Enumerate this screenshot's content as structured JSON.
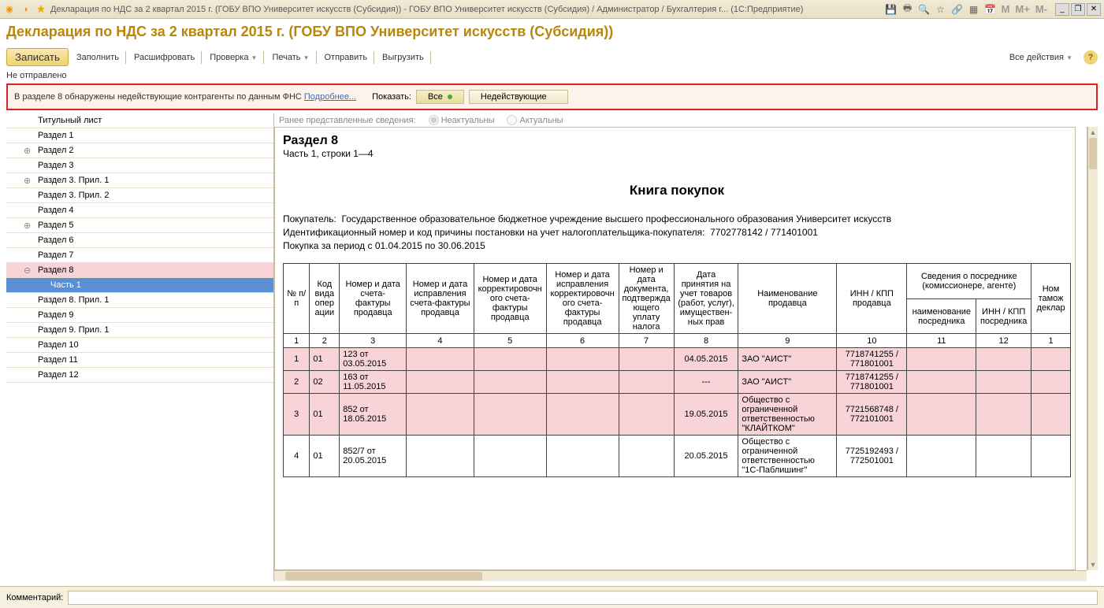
{
  "titlebar": {
    "text": "Декларация по НДС за 2 квартал 2015 г. (ГОБУ ВПО Университет искусств (Субсидия)) - ГОБУ ВПО Университет искусств (Субсидия) / Администратор / Бухгалтерия г...  (1С:Предприятие)"
  },
  "page_title": "Декларация по НДС за 2 квартал 2015 г. (ГОБУ ВПО Университет искусств (Субсидия))",
  "toolbar": {
    "write": "Записать",
    "fill": "Заполнить",
    "decode": "Расшифровать",
    "check": "Проверка",
    "print": "Печать",
    "send": "Отправить",
    "export": "Выгрузить",
    "all_actions": "Все действия"
  },
  "status_line": "Не отправлено",
  "warning": {
    "text_before": "В разделе 8 обнаружены недействующие контрагенты по данным ФНС ",
    "link": "Подробнее...",
    "show_label": "Показать:",
    "btn_all": "Все",
    "btn_inactive": "Недействующие"
  },
  "sidebar": [
    {
      "label": "Титульный лист",
      "type": "plain"
    },
    {
      "label": "Раздел 1",
      "type": "plain"
    },
    {
      "label": "Раздел 2",
      "type": "expandable"
    },
    {
      "label": "Раздел 3",
      "type": "plain"
    },
    {
      "label": "Раздел 3. Прил. 1",
      "type": "expandable"
    },
    {
      "label": "Раздел 3. Прил. 2",
      "type": "plain"
    },
    {
      "label": "Раздел 4",
      "type": "plain"
    },
    {
      "label": "Раздел 5",
      "type": "expandable"
    },
    {
      "label": "Раздел 6",
      "type": "plain"
    },
    {
      "label": "Раздел 7",
      "type": "plain"
    },
    {
      "label": "Раздел 8",
      "type": "expanded",
      "highlighted": true
    },
    {
      "label": "Часть 1",
      "type": "child",
      "selected": true
    },
    {
      "label": "Раздел 8. Прил. 1",
      "type": "plain"
    },
    {
      "label": "Раздел 9",
      "type": "plain"
    },
    {
      "label": "Раздел 9. Прил. 1",
      "type": "plain"
    },
    {
      "label": "Раздел 10",
      "type": "plain"
    },
    {
      "label": "Раздел 11",
      "type": "plain"
    },
    {
      "label": "Раздел 12",
      "type": "plain"
    }
  ],
  "report_meta": {
    "prev_label": "Ранее представленные сведения:",
    "opt1": "Неактуальны",
    "opt2": "Актуальны"
  },
  "report": {
    "section_title": "Раздел 8",
    "section_sub": "Часть 1, строки 1—4",
    "center_title": "Книга покупок",
    "buyer_line1_label": "Покупатель:",
    "buyer_line1_value": "Государственное образовательное бюджетное учреждение высшего профессионального образования  Университет искусств",
    "buyer_line2_label": "Идентификационный номер и код причины постановки на учет налогоплательщика-покупателя:",
    "buyer_line2_value": "7702778142 / 771401001",
    "buyer_line3": "Покупка за период с 01.04.2015 по 30.06.2015"
  },
  "table": {
    "headers": {
      "c1": "№ п/п",
      "c2": "Код вида опер ации",
      "c3": "Номер и дата счета-фактуры продавца",
      "c4": "Номер и дата исправления счета-фактуры продавца",
      "c5": "Номер и дата корректировочн ого счета-фактуры продавца",
      "c6": "Номер и дата исправления корректировочн ого счета-фактуры продавца",
      "c7": "Номер и дата документа, подтвержда ющего уплату налога",
      "c8": "Дата принятия на учет товаров (работ, услуг), имуществен- ных прав",
      "c9": "Наименование продавца",
      "c10": "ИНН / КПП продавца",
      "c11_group": "Сведения о посреднике (комиссионере, агенте)",
      "c11": "наименование посредника",
      "c12": "ИНН / КПП посредника",
      "c13": "Ном тамож деклар"
    },
    "col_nums": [
      "1",
      "2",
      "3",
      "4",
      "5",
      "6",
      "7",
      "8",
      "9",
      "10",
      "11",
      "12",
      "1"
    ],
    "rows": [
      {
        "n": "1",
        "code": "01",
        "inv": "123 от 03.05.2015",
        "c4": "",
        "c5": "",
        "c6": "",
        "c7": "",
        "date": "04.05.2015",
        "seller": "ЗАО \"АИСТ\"",
        "inn": "7718741255 / 771801001",
        "c11": "",
        "c12": "",
        "c13": "",
        "pink": true
      },
      {
        "n": "2",
        "code": "02",
        "inv": "163 от 11.05.2015",
        "c4": "",
        "c5": "",
        "c6": "",
        "c7": "",
        "date": "---",
        "seller": "ЗАО \"АИСТ\"",
        "inn": "7718741255 / 771801001",
        "c11": "",
        "c12": "",
        "c13": "",
        "pink": true
      },
      {
        "n": "3",
        "code": "01",
        "inv": "852 от 18.05.2015",
        "c4": "",
        "c5": "",
        "c6": "",
        "c7": "",
        "date": "19.05.2015",
        "seller": "Общество с ограниченной ответственностью \"КЛАЙТКОМ\"",
        "inn": "7721568748 / 772101001",
        "c11": "",
        "c12": "",
        "c13": "",
        "pink": true
      },
      {
        "n": "4",
        "code": "01",
        "inv": "852/7 от 20.05.2015",
        "c4": "",
        "c5": "",
        "c6": "",
        "c7": "",
        "date": "20.05.2015",
        "seller": "Общество с ограниченной ответственностью \"1С-Паблишинг\"",
        "inn": "7725192493 / 772501001",
        "c11": "",
        "c12": "",
        "c13": "",
        "pink": false
      }
    ]
  },
  "footer": {
    "label": "Комментарий:",
    "value": ""
  }
}
